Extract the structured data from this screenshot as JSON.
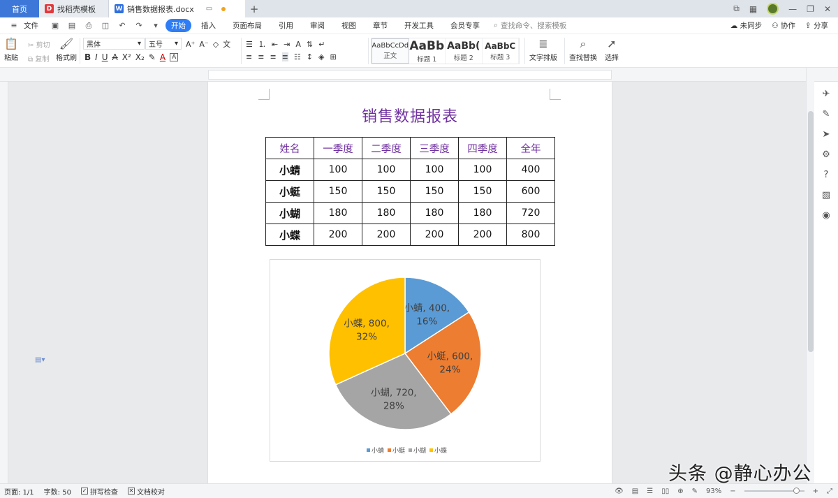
{
  "tabs": {
    "home": "首页",
    "template": "找稻壳模板",
    "document": "销售数据报表.docx"
  },
  "menu": {
    "file": "文件",
    "items": [
      "开始",
      "插入",
      "页面布局",
      "引用",
      "审阅",
      "视图",
      "章节",
      "开发工具",
      "会员专享"
    ],
    "search_placeholder": "查找命令、搜索模板",
    "right": [
      "未同步",
      "协作",
      "分享"
    ]
  },
  "ribbon": {
    "paste": "粘贴",
    "cut": "剪切",
    "copy": "复制",
    "format_painter": "格式刷",
    "font_name": "黑体",
    "font_size": "五号",
    "styles": [
      {
        "sample": "AaBbCcDd",
        "label": "正文"
      },
      {
        "sample": "AaBb",
        "label": "标题 1"
      },
      {
        "sample": "AaBb(",
        "label": "标题 2"
      },
      {
        "sample": "AaBbC",
        "label": "标题 3"
      }
    ],
    "text_layout": "文字排版",
    "find_replace": "查找替换",
    "select": "选择"
  },
  "document": {
    "title": "销售数据报表",
    "table": {
      "header": [
        "姓名",
        "一季度",
        "二季度",
        "三季度",
        "四季度",
        "全年"
      ],
      "rows": [
        [
          "小蜻",
          "100",
          "100",
          "100",
          "100",
          "400"
        ],
        [
          "小蜓",
          "150",
          "150",
          "150",
          "150",
          "600"
        ],
        [
          "小蝴",
          "180",
          "180",
          "180",
          "180",
          "720"
        ],
        [
          "小蝶",
          "200",
          "200",
          "200",
          "200",
          "800"
        ]
      ]
    }
  },
  "chart_data": {
    "type": "pie",
    "categories": [
      "小蜻",
      "小蜓",
      "小蝴",
      "小蝶"
    ],
    "values": [
      400,
      600,
      720,
      800
    ],
    "labels": [
      "小蜻, 400,\n16%",
      "小蜓, 600,\n24%",
      "小蝴, 720,\n28%",
      "小蝶, 800,\n32%"
    ],
    "colors": [
      "#5b9bd5",
      "#ed7d31",
      "#a5a5a5",
      "#ffc000"
    ],
    "legend_position": "bottom",
    "title": ""
  },
  "status": {
    "page": "页面: 1/1",
    "words": "字数: 50",
    "spell_check": "拼写检查",
    "doc_proofread": "文档校对",
    "zoom": "93%"
  },
  "watermark": "头条 @静心办公"
}
